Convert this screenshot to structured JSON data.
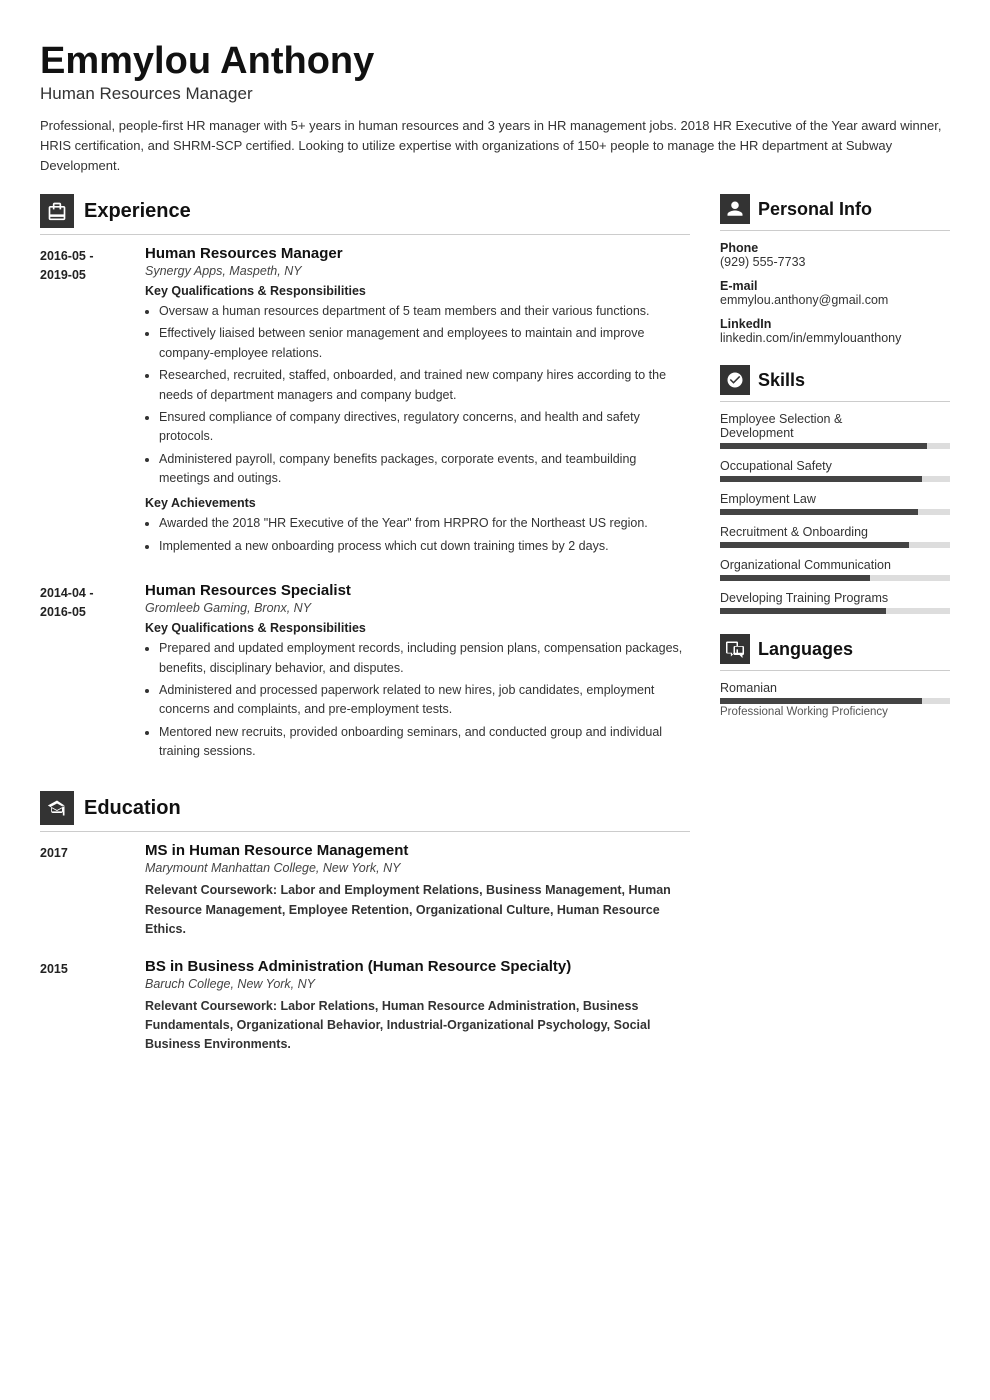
{
  "header": {
    "name": "Emmylou Anthony",
    "title": "Human Resources Manager",
    "summary": "Professional, people-first HR manager with 5+ years in human resources and 3 years in HR management jobs. 2018 HR Executive of the Year award winner, HRIS certification, and SHRM-SCP certified. Looking to utilize expertise with organizations of 150+ people to manage the HR department at Subway Development."
  },
  "experience": {
    "section_title": "Experience",
    "entries": [
      {
        "date": "2016-05 -\n2019-05",
        "title": "Human Resources Manager",
        "company": "Synergy Apps, Maspeth, NY",
        "qualifications_header": "Key Qualifications & Responsibilities",
        "qualifications": [
          "Oversaw a human resources department of 5 team members and their various functions.",
          "Effectively liaised between senior management and employees to maintain and improve company-employee relations.",
          "Researched, recruited, staffed, onboarded, and trained new company hires according to the needs of department managers and company budget.",
          "Ensured compliance of company directives, regulatory concerns, and health and safety protocols.",
          "Administered payroll, company benefits packages, corporate events, and teambuilding meetings and outings."
        ],
        "achievements_header": "Key Achievements",
        "achievements": [
          "Awarded the 2018 \"HR Executive of the Year\" from HRPRO for the Northeast US region.",
          "Implemented a new onboarding process which cut down training times by 2 days."
        ]
      },
      {
        "date": "2014-04 -\n2016-05",
        "title": "Human Resources Specialist",
        "company": "Gromleeb Gaming, Bronx, NY",
        "qualifications_header": "Key Qualifications & Responsibilities",
        "qualifications": [
          "Prepared and updated employment records, including pension plans, compensation packages, benefits, disciplinary behavior, and disputes.",
          "Administered and processed paperwork related to new hires, job candidates, employment concerns and complaints, and pre-employment tests.",
          "Mentored new recruits, provided onboarding seminars, and conducted group and individual training sessions."
        ],
        "achievements_header": "",
        "achievements": []
      }
    ]
  },
  "education": {
    "section_title": "Education",
    "entries": [
      {
        "date": "2017",
        "title": "MS in Human Resource Management",
        "company": "Marymount Manhattan College, New York, NY",
        "coursework_label": "Relevant Coursework:",
        "coursework": "Labor and Employment Relations, Business Management, Human Resource Management, Employee Retention, Organizational Culture, Human Resource Ethics."
      },
      {
        "date": "2015",
        "title": "BS in Business Administration (Human Resource Specialty)",
        "company": "Baruch College, New York, NY",
        "coursework_label": "Relevant Coursework:",
        "coursework": "Labor Relations, Human Resource Administration, Business Fundamentals, Organizational Behavior, Industrial-Organizational Psychology, Social Business Environments."
      }
    ]
  },
  "personal_info": {
    "section_title": "Personal Info",
    "items": [
      {
        "label": "Phone",
        "value": "(929) 555-7733"
      },
      {
        "label": "E-mail",
        "value": "emmylou.anthony@gmail.com"
      },
      {
        "label": "LinkedIn",
        "value": "linkedin.com/in/emmylouanthony"
      }
    ]
  },
  "skills": {
    "section_title": "Skills",
    "items": [
      {
        "name": "Employee Selection &\nDevelopment",
        "pct": 90
      },
      {
        "name": "Occupational Safety",
        "pct": 88
      },
      {
        "name": "Employment Law",
        "pct": 86
      },
      {
        "name": "Recruitment & Onboarding",
        "pct": 82
      },
      {
        "name": "Organizational Communication",
        "pct": 65
      },
      {
        "name": "Developing Training Programs",
        "pct": 72
      }
    ]
  },
  "languages": {
    "section_title": "Languages",
    "items": [
      {
        "name": "Romanian",
        "pct": 88,
        "level": "Professional Working Proficiency"
      }
    ]
  }
}
